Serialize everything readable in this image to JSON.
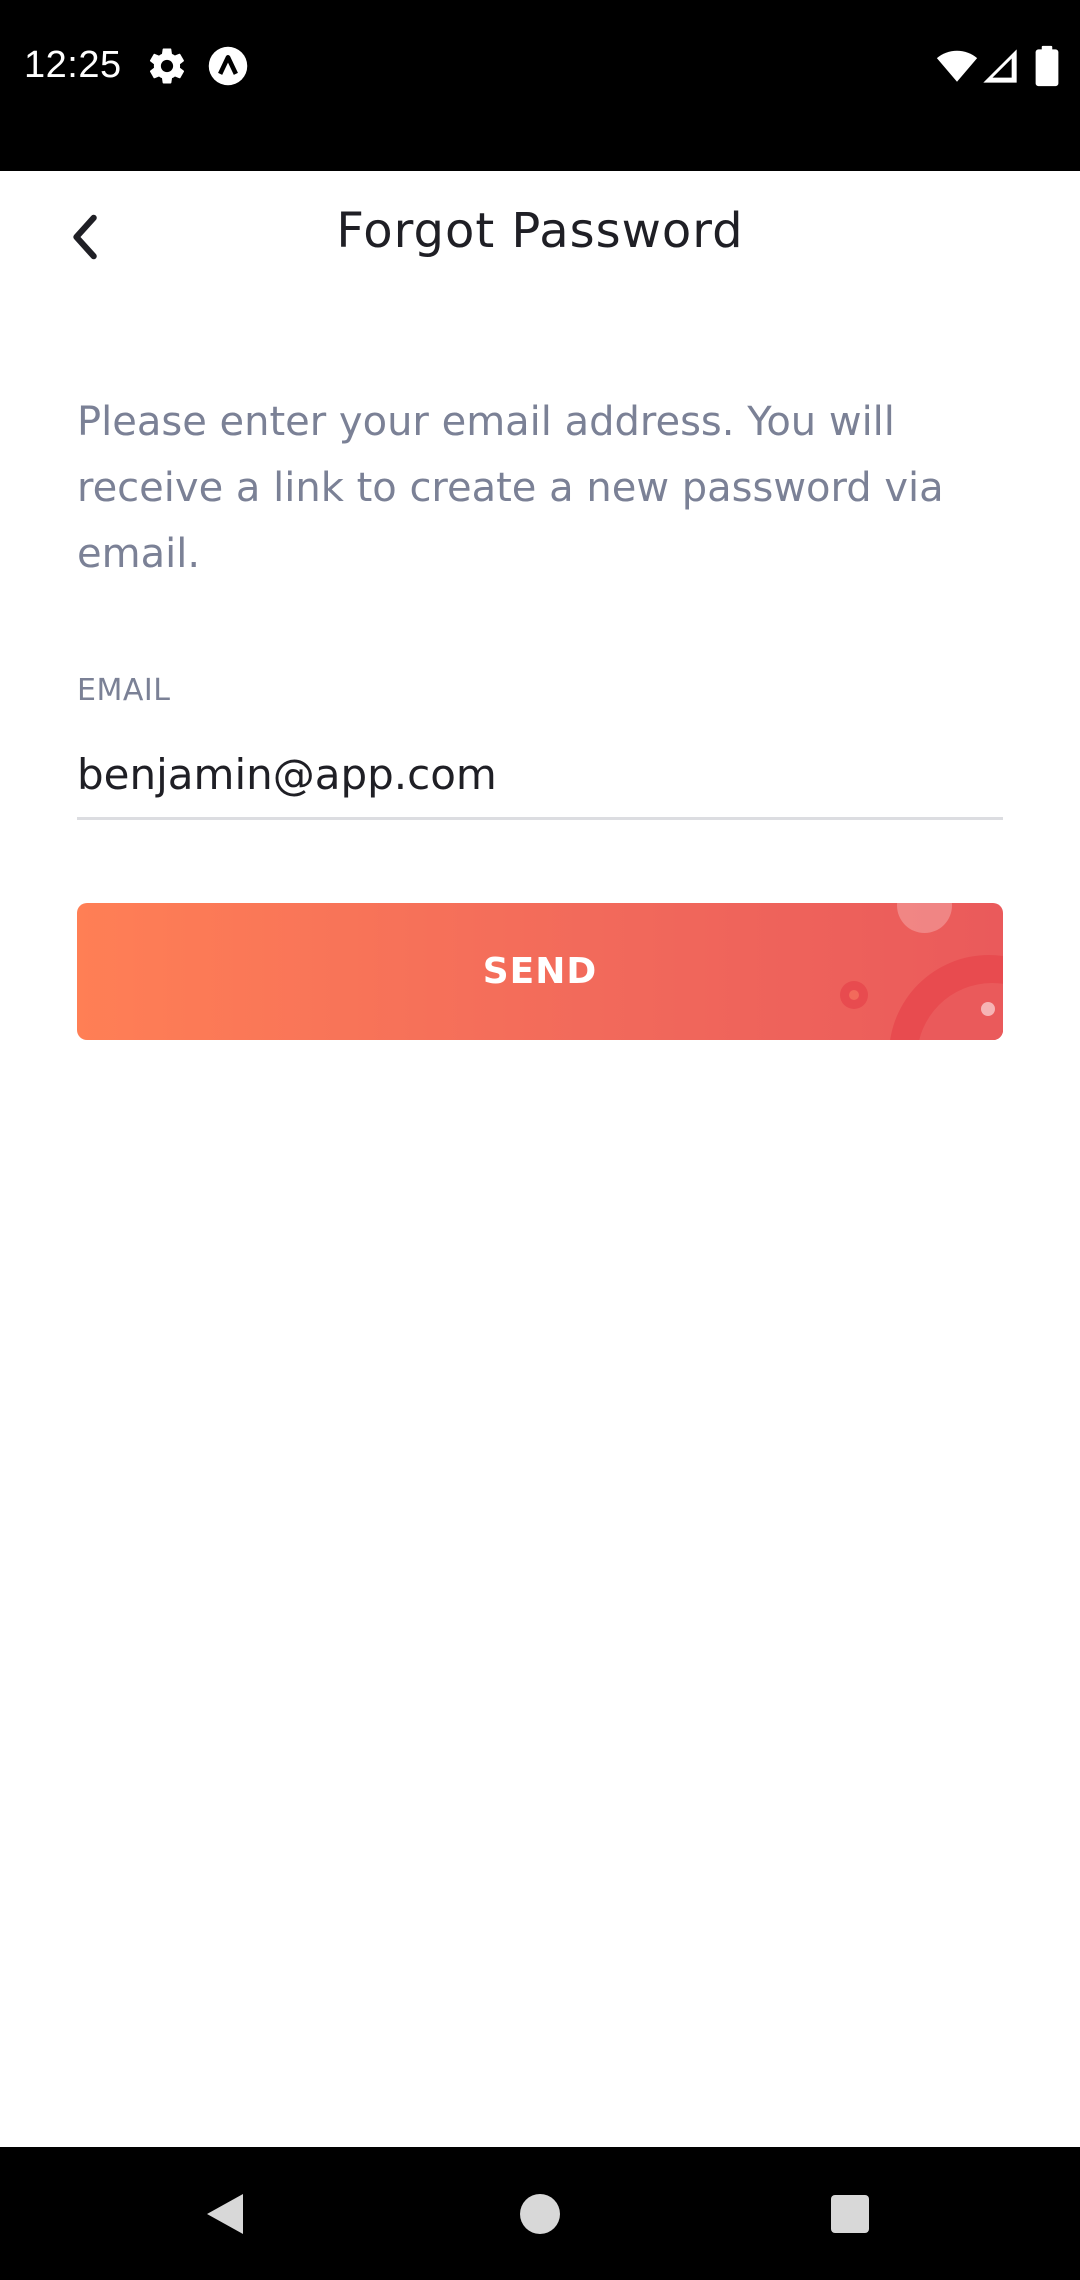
{
  "status_bar": {
    "time": "12:25",
    "icons": [
      "gear-icon",
      "app-notification-icon",
      "wifi-icon",
      "cellular-signal-icon",
      "battery-icon"
    ]
  },
  "header": {
    "title": "Forgot Password",
    "back_icon": "chevron-left-icon"
  },
  "form": {
    "instructions": "Please enter your email address. You will receive a link to create a new password via email.",
    "email_label": "EMAIL",
    "email_value": "benjamin@app.com",
    "send_label": "SEND"
  },
  "nav_bar": {
    "icons": [
      "back-triangle-icon",
      "home-circle-icon",
      "recents-square-icon"
    ]
  },
  "colors": {
    "accent_start": "#ff7f55",
    "accent_end": "#ea5a5b",
    "title_text": "#1f1f25",
    "muted_text": "#7b8196"
  }
}
